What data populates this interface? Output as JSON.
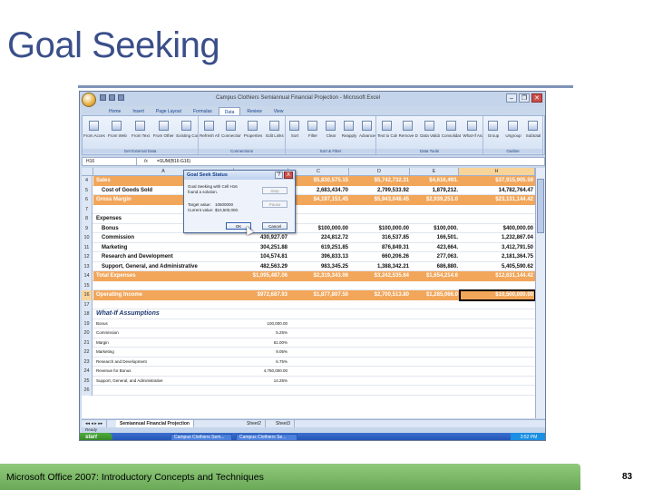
{
  "slide": {
    "title": "Goal Seeking",
    "footer": "Microsoft Office 2007: Introductory Concepts and Techniques",
    "page_number": "83"
  },
  "excel": {
    "window_title": "Campus Clothiers Semiannual Financial Projection - Microsoft Excel",
    "tabs": [
      {
        "label": "Home",
        "active": false
      },
      {
        "label": "Insert",
        "active": false
      },
      {
        "label": "Page Layout",
        "active": false
      },
      {
        "label": "Formulas",
        "active": false
      },
      {
        "label": "Data",
        "active": true
      },
      {
        "label": "Review",
        "active": false
      },
      {
        "label": "View",
        "active": false
      }
    ],
    "ribbon_groups": [
      {
        "name": "Get External Data",
        "buttons": [
          "From Access",
          "From Web",
          "From Text",
          "From Other Sources",
          "Existing Connections"
        ]
      },
      {
        "name": "Connections",
        "buttons": [
          "Refresh All",
          "Connections",
          "Properties",
          "Edit Links"
        ]
      },
      {
        "name": "Sort & Filter",
        "buttons": [
          "Sort",
          "Filter",
          "Clear",
          "Reapply",
          "Advanced"
        ]
      },
      {
        "name": "Data Tools",
        "buttons": [
          "Text to Columns",
          "Remove Duplicates",
          "Data Validation",
          "Consolidate",
          "What-If Analysis"
        ]
      },
      {
        "name": "Outline",
        "buttons": [
          "Group",
          "Ungroup",
          "Subtotal"
        ]
      }
    ],
    "name_box": "H16",
    "fx_label": "fx",
    "formula": "=SUM(B16:G16)",
    "columns": [
      "A",
      "C",
      "D",
      "E",
      "H"
    ],
    "rows": [
      {
        "n": "4",
        "style": "orange",
        "a": "Sales",
        "b": "",
        "c": "$5,830,575.15",
        "d": "$5,742,732.31",
        "e": "$4,616,493.",
        "h": "$37,915,905.59"
      },
      {
        "n": "5",
        "style": "bold",
        "a": "Cost of Goods Sold",
        "b": "",
        "c": "2,683,434.70",
        "d": "2,799,533.92",
        "e": "1,879,212.",
        "h": "14,782,764.47"
      },
      {
        "n": "6",
        "style": "orange",
        "a": "Gross Margin",
        "b": "",
        "c": "$4,197,151.45",
        "d": "$5,943,048.45",
        "e": "$2,939,251.0",
        "h": "$23,131,144.42"
      },
      {
        "n": "7",
        "style": "",
        "a": "",
        "b": "",
        "c": "",
        "d": "",
        "e": "",
        "h": ""
      },
      {
        "n": "8",
        "style": "bold",
        "a": "Expenses",
        "b": "",
        "c": "",
        "d": "",
        "e": "",
        "h": ""
      },
      {
        "n": "9",
        "style": "bold",
        "a": "Bonus",
        "b": "",
        "c": "$100,000.00",
        "d": "$100,000.00",
        "e": "$100,000.",
        "h": "$400,000.00"
      },
      {
        "n": "10",
        "style": "bold",
        "a": "Commission",
        "b": "430,927.07",
        "c": "224,812.72",
        "d": "316,537.85",
        "e": "166,501.",
        "h": "1,232,867.04"
      },
      {
        "n": "11",
        "style": "bold",
        "a": "Marketing",
        "b": "304,251.88",
        "c": "619,251.85",
        "d": "876,849.31",
        "e": "423,664.",
        "h": "3,412,791.50"
      },
      {
        "n": "12",
        "style": "bold",
        "a": "Research and Development",
        "b": "104,574.81",
        "c": "396,833.13",
        "d": "660,206.26",
        "e": "277,063.",
        "h": "2,181,364.75"
      },
      {
        "n": "13",
        "style": "bold",
        "a": "Support, General, and Administrative",
        "b": "482,563.29",
        "c": "983,345.25",
        "d": "1,388,342.21",
        "e": "686,880.",
        "h": "5,405,590.62"
      },
      {
        "n": "14",
        "style": "orange",
        "a": "Total Expenses",
        "b": "$1,095,487.06",
        "c": "$2,319,343.06",
        "d": "$3,242,535.64",
        "e": "$1,654,214.6",
        "h": "$12,631,144.42"
      },
      {
        "n": "15",
        "style": "",
        "a": "",
        "b": "",
        "c": "",
        "d": "",
        "e": "",
        "h": ""
      },
      {
        "n": "16",
        "style": "orange",
        "a": "Operating Income",
        "b": "$972,687.93",
        "c": "$1,877,807.50",
        "d": "$2,700,513.80",
        "e": "$1,285,066.0",
        "h": "$10,500,000.00"
      },
      {
        "n": "17",
        "style": "",
        "a": "",
        "b": "",
        "c": "",
        "d": "",
        "e": "",
        "h": ""
      },
      {
        "n": "18",
        "style": "head",
        "a": "What-If Assumptions",
        "b": "",
        "c": "",
        "d": "",
        "e": "",
        "h": ""
      },
      {
        "n": "19",
        "style": "small",
        "a": "Bonus",
        "b": "100,000.00",
        "c": "",
        "d": "",
        "e": "",
        "h": ""
      },
      {
        "n": "20",
        "style": "small",
        "a": "Commission",
        "b": "5.25%",
        "c": "",
        "d": "",
        "e": "",
        "h": ""
      },
      {
        "n": "21",
        "style": "small",
        "a": "Margin",
        "b": "61.00%",
        "c": "",
        "d": "",
        "e": "",
        "h": ""
      },
      {
        "n": "22",
        "style": "small",
        "a": "Marketing",
        "b": "9.05%",
        "c": "",
        "d": "",
        "e": "",
        "h": ""
      },
      {
        "n": "23",
        "style": "small",
        "a": "Research and Development",
        "b": "6.75%",
        "c": "",
        "d": "",
        "e": "",
        "h": ""
      },
      {
        "n": "24",
        "style": "small",
        "a": "Revenue for Bonus",
        "b": "4,750,000.00",
        "c": "",
        "d": "",
        "e": "",
        "h": ""
      },
      {
        "n": "25",
        "style": "small",
        "a": "Support, General, and Administrative",
        "b": "14.25%",
        "c": "",
        "d": "",
        "e": "",
        "h": ""
      },
      {
        "n": "26",
        "style": "",
        "a": "",
        "b": "",
        "c": "",
        "d": "",
        "e": "",
        "h": ""
      }
    ],
    "sheet_tabs": [
      "Semiannual Financial Projection",
      "Sheet2",
      "Sheet3"
    ],
    "status": "Ready",
    "taskbar": {
      "start": "start",
      "items": [
        "Campus Clothiers Sem...",
        "Campus Clothiers Se..."
      ],
      "clock": "3:52 PM"
    },
    "goal_seek": {
      "title": "Goal Seek Status",
      "help": "?",
      "close": "X",
      "line1": "Goal Seeking with Cell H16",
      "line2": "found a solution.",
      "target_label": "Target value:",
      "target_value": "10500000",
      "current_label": "Current value:",
      "current_value": "$10,500,000.",
      "step": "Step",
      "pause": "Pause",
      "ok": "OK",
      "cancel": "Cancel"
    }
  }
}
